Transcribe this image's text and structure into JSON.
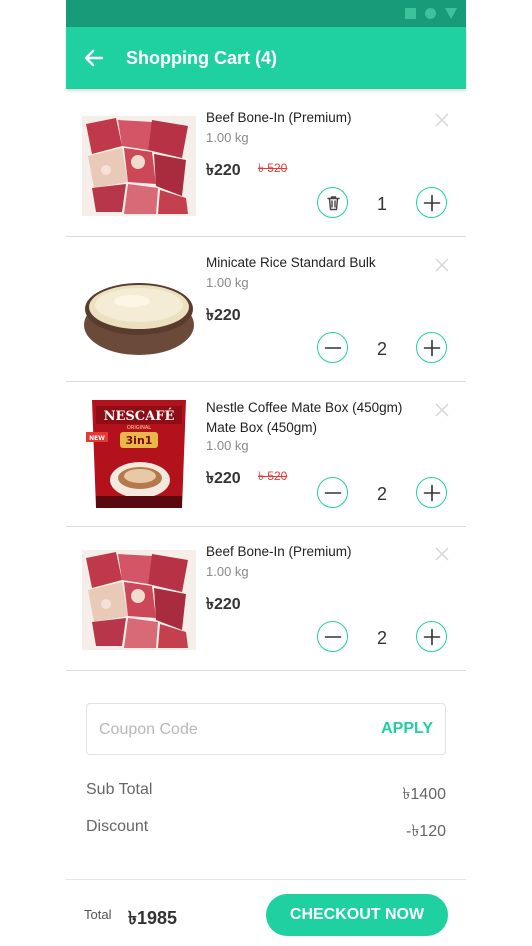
{
  "header": {
    "title": "Shopping Cart (4)"
  },
  "items": [
    {
      "name": "Beef Bone-In (Premium)",
      "weight": "1.00 kg",
      "price": "৳220",
      "old_price": "৳ 520",
      "qty": "1",
      "image": "beef-image"
    },
    {
      "name": "Minicate Rice Standard Bulk",
      "weight": "1.00 kg",
      "price": "৳220",
      "old_price": "",
      "qty": "2",
      "image": "rice-image"
    },
    {
      "name": "Nestle Coffee Mate Box (450gm) Mate Box (450gm)",
      "weight": "1.00 kg",
      "price": "৳220",
      "old_price": "৳ 520",
      "qty": "2",
      "image": "nescafe-image",
      "pack": {
        "brand": "NESCAFÉ",
        "sub": "ORIGINAL",
        "badge": "3in1",
        "tag": "NEW"
      }
    },
    {
      "name": "Beef Bone-In (Premium)",
      "weight": "1.00 kg",
      "price": "৳220",
      "old_price": "",
      "qty": "2",
      "image": "beef-image"
    }
  ],
  "coupon": {
    "placeholder": "Coupon Code",
    "value": "",
    "apply_label": "APPLY"
  },
  "summary": {
    "subtotal_label": "Sub Total",
    "subtotal_value": "৳1400",
    "discount_label": "Discount",
    "discount_value": "-৳120"
  },
  "footer": {
    "total_label": "Total",
    "total_value": "৳1985",
    "checkout_label": "CHECKOUT NOW"
  },
  "colors": {
    "accent": "#1fd0a1",
    "statusbar": "#189b78",
    "strike_price": "#e53935"
  }
}
